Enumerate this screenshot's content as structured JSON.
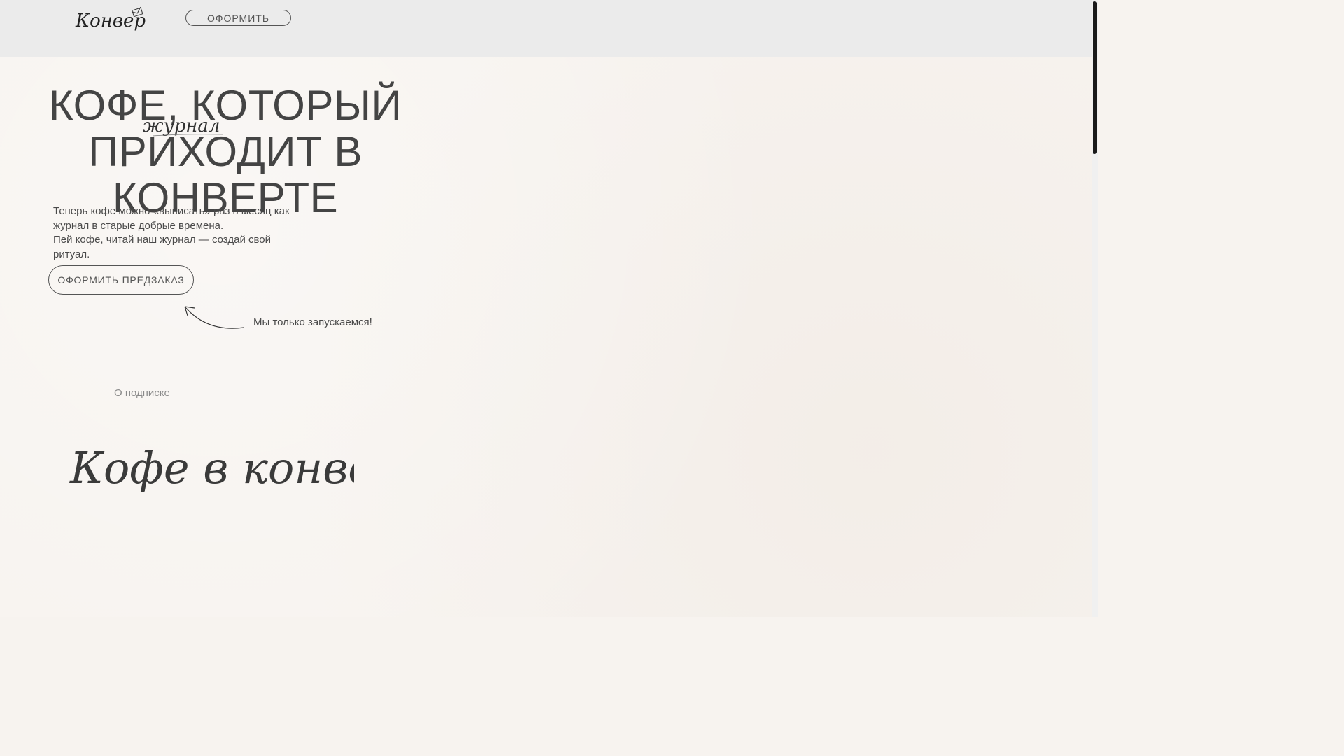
{
  "header": {
    "logo_text": "Конверт",
    "cta_label": "ОФОРМИТЬ"
  },
  "hero": {
    "title_line1": "КОФЕ, КОТОРЫЙ",
    "title_line2": "ПРИХОДИТ В",
    "title_line3": "КОНВЕРТЕ",
    "script_word": "журнал",
    "paragraph1": "Теперь кофе можно «выписать» раз в месяц как журнал в старые добрые времена.",
    "paragraph2": "Пей кофе, читай наш журнал — создай свой ритуал.",
    "preorder_label": "ОФОРМИТЬ ПРЕДЗАКАЗ",
    "launch_note": "Мы только запускаемся!"
  },
  "section": {
    "label": "О подписке",
    "script_heading": "Кофе в конверте"
  },
  "colors": {
    "header_bg": "#ebebeb",
    "page_bg": "#f7f3ef",
    "text": "#444444",
    "muted": "#8a8a8a"
  }
}
